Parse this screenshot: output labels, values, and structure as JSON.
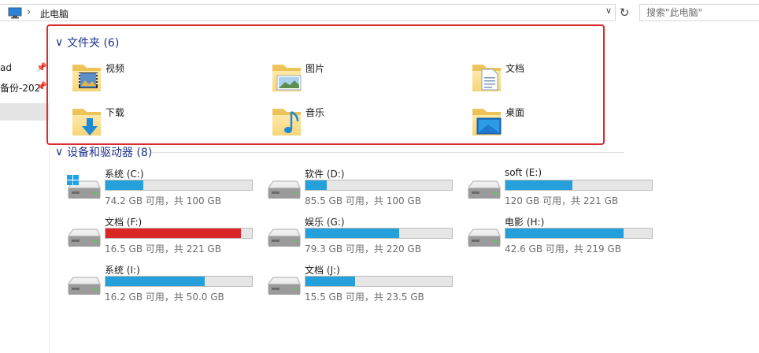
{
  "address": {
    "crumb": "此电脑",
    "separator": "›",
    "dropdown": "∨",
    "refresh": "↻"
  },
  "search": {
    "placeholder": "搜索\"此电脑\""
  },
  "nav": {
    "items": [
      {
        "label": "ad",
        "pin": "📌"
      },
      {
        "label": "备份-202",
        "pin": "📌"
      },
      {
        "label": ""
      }
    ]
  },
  "folders_header": {
    "chevron": "∨",
    "label": "文件夹 (6)"
  },
  "folders": [
    {
      "label": "视频",
      "icon": "video-folder-icon"
    },
    {
      "label": "图片",
      "icon": "pictures-folder-icon"
    },
    {
      "label": "文档",
      "icon": "documents-folder-icon"
    },
    {
      "label": "下载",
      "icon": "downloads-folder-icon"
    },
    {
      "label": "音乐",
      "icon": "music-folder-icon"
    },
    {
      "label": "桌面",
      "icon": "desktop-folder-icon"
    }
  ],
  "drives_header": {
    "chevron": "∨",
    "label": "设备和驱动器 (8)"
  },
  "drives": [
    {
      "name": "系统 (C:)",
      "info": "74.2 GB 可用，共 100 GB",
      "used_fraction": 0.258,
      "bar_color": "#26a0da",
      "icon": "windows-drive-icon"
    },
    {
      "name": "软件 (D:)",
      "info": "85.5 GB 可用，共 100 GB",
      "used_fraction": 0.145,
      "bar_color": "#26a0da",
      "icon": "hard-drive-icon"
    },
    {
      "name": "soft (E:)",
      "info": "120 GB 可用，共 221 GB",
      "used_fraction": 0.457,
      "bar_color": "#26a0da",
      "icon": "hard-drive-icon"
    },
    {
      "name": "文档 (F:)",
      "info": "16.5 GB 可用，共 221 GB",
      "used_fraction": 0.925,
      "bar_color": "#da2626",
      "icon": "hard-drive-icon"
    },
    {
      "name": "娱乐 (G:)",
      "info": "79.3 GB 可用，共 220 GB",
      "used_fraction": 0.64,
      "bar_color": "#26a0da",
      "icon": "hard-drive-icon"
    },
    {
      "name": "电影 (H:)",
      "info": "42.6 GB 可用，共 219 GB",
      "used_fraction": 0.805,
      "bar_color": "#26a0da",
      "icon": "hard-drive-icon"
    },
    {
      "name": "系统 (I:)",
      "info": "16.2 GB 可用，共 50.0 GB",
      "used_fraction": 0.676,
      "bar_color": "#26a0da",
      "icon": "hard-drive-icon"
    },
    {
      "name": "文档 (J:)",
      "info": "15.5 GB 可用，共 23.5 GB",
      "used_fraction": 0.34,
      "bar_color": "#26a0da",
      "icon": "hard-drive-icon"
    }
  ]
}
